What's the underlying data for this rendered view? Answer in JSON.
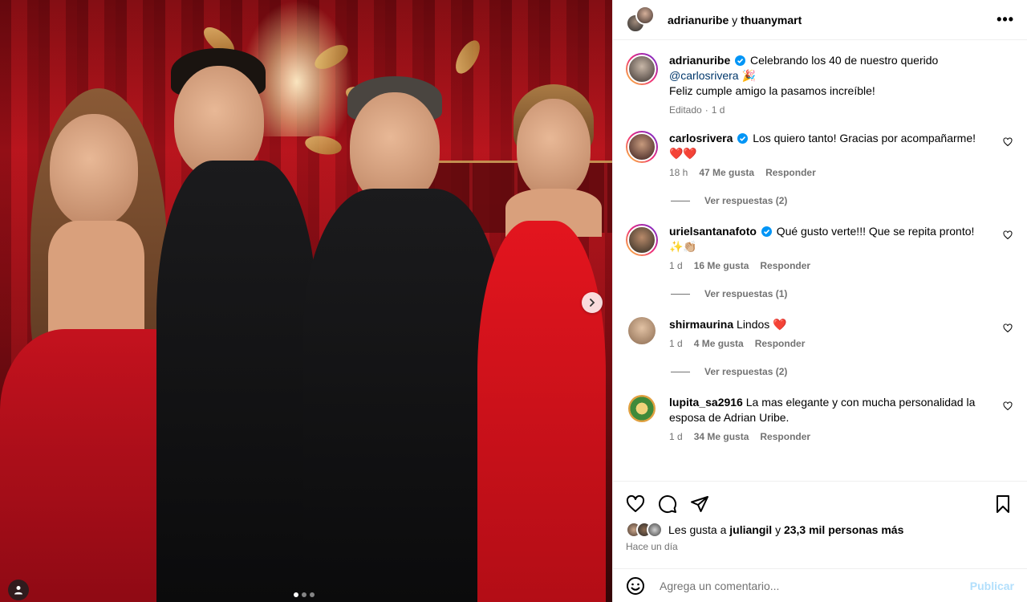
{
  "header": {
    "user1": "adrianuribe",
    "joiner": "y",
    "user2": "thuanymart",
    "more_icon": "more-horizontal-icon"
  },
  "caption": {
    "user": "adrianuribe",
    "text1": "Celebrando los 40 de nuestro querido",
    "mention": "@carlosrivera",
    "emoji": "🎉",
    "text2": "Feliz cumple amigo la pasamos increíble!",
    "edited": "Editado",
    "sep": "·",
    "time": "1 d"
  },
  "comments": [
    {
      "user": "carlosrivera",
      "verified": true,
      "text": "Los quiero tanto! Gracias por acompañarme!",
      "text2": "❤️❤️",
      "time": "18 h",
      "likes": "47 Me gusta",
      "reply": "Responder",
      "replies": "Ver respuestas (2)"
    },
    {
      "user": "urielsantanafoto",
      "verified": true,
      "text": "Qué gusto verte!!! Que se repita pronto!",
      "text2": "✨👏🏼",
      "time": "1 d",
      "likes": "16 Me gusta",
      "reply": "Responder",
      "replies": "Ver respuestas (1)"
    },
    {
      "user": "shirmaurina",
      "verified": false,
      "text": "Lindos ❤️",
      "time": "1 d",
      "likes": "4 Me gusta",
      "reply": "Responder",
      "replies": "Ver respuestas (2)"
    },
    {
      "user": "lupita_sa2916",
      "verified": false,
      "text": "La mas elegante y con mucha personalidad la esposa de Adrian Uribe.",
      "time": "1 d",
      "likes": "34 Me gusta",
      "reply": "Responder"
    }
  ],
  "actions": {
    "icons": [
      "heart-icon",
      "comment-icon",
      "share-icon",
      "bookmark-icon"
    ],
    "likes_prefix": "Les gusta a",
    "likes_user": "juliangil",
    "likes_and": "y",
    "likes_count": "23,3 mil personas más",
    "time": "Hace un día"
  },
  "add_comment": {
    "placeholder": "Agrega un comentario...",
    "publish": "Publicar"
  },
  "carousel": {
    "total": 3,
    "active": 0
  },
  "colors": {
    "verified": "#0095f6",
    "mention": "#00376b",
    "muted": "#737373",
    "publish_disabled": "#b2dffc"
  }
}
